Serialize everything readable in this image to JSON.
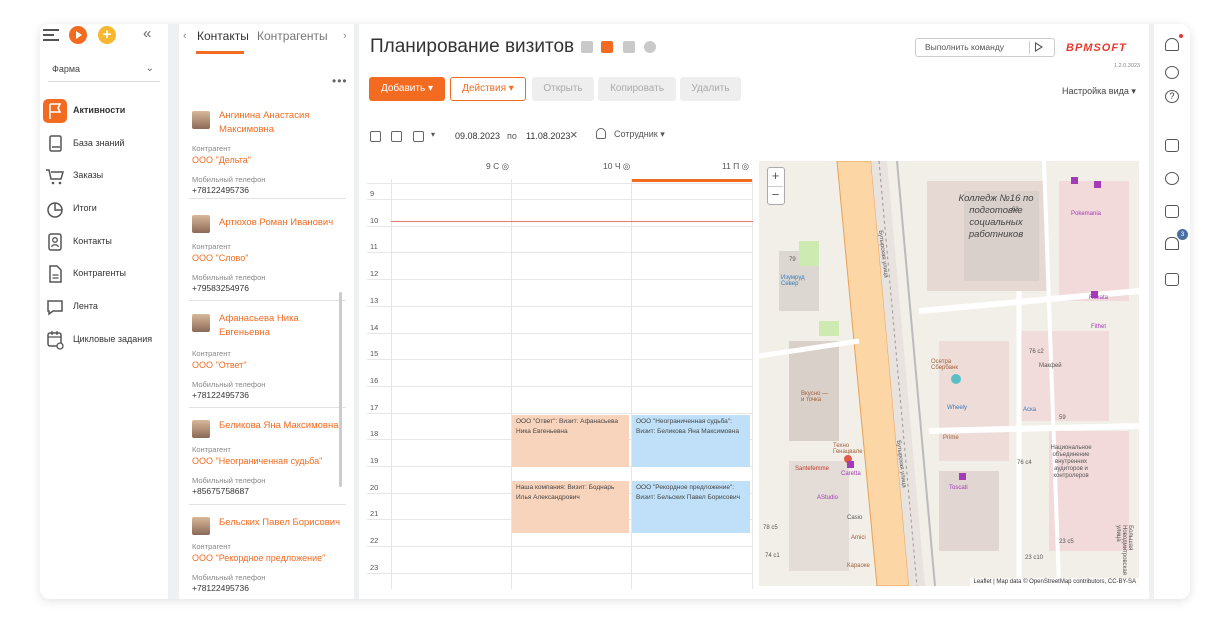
{
  "workspace": "Фарма",
  "nav": [
    {
      "label": "Активности",
      "icon": "flag-icon"
    },
    {
      "label": "База знаний",
      "icon": "book-icon"
    },
    {
      "label": "Заказы",
      "icon": "cart-icon"
    },
    {
      "label": "Итоги",
      "icon": "pie-chart-icon"
    },
    {
      "label": "Контакты",
      "icon": "contact-card-icon"
    },
    {
      "label": "Контрагенты",
      "icon": "document-icon"
    },
    {
      "label": "Лента",
      "icon": "chat-icon"
    },
    {
      "label": "Цикловые задания",
      "icon": "calendar-location-icon"
    }
  ],
  "contacts": {
    "tabs": [
      "Контакты",
      "Контрагенты"
    ],
    "field_account": "Контрагент",
    "field_phone": "Мобильный телефон",
    "items": [
      {
        "name": "Ангинина Анастасия Максимовна",
        "account": "ООО \"Дельта\"",
        "phone": "+78122495736"
      },
      {
        "name": "Артюхов Роман Иванович",
        "account": "ООО \"Слово\"",
        "phone": "+79583254976"
      },
      {
        "name": "Афанасьева Ника Евгеньевна",
        "account": "ООО \"Ответ\"",
        "phone": "+78122495736"
      },
      {
        "name": "Беликова Яна Максимовна",
        "account": "ООО \"Неограниченная судьба\"",
        "phone": "+85675758687"
      },
      {
        "name": "Бельских Павел Борисович",
        "account": "ООО \"Рекордное предложение\"",
        "phone": "+78122495736"
      }
    ]
  },
  "header": {
    "title": "Планирование визитов",
    "add": "Добавить",
    "actions": "Действия",
    "open": "Открыть",
    "copy": "Копировать",
    "delete": "Удалить",
    "command_placeholder": "Выполнить команду",
    "logo": "BPMSOFT",
    "version": "1.2.0.3023",
    "view_settings": "Настройка вида"
  },
  "filter": {
    "date_from": "09.08.2023",
    "to": "по",
    "date_to": "11.08.2023",
    "employee": "Сотрудник"
  },
  "schedule": {
    "days": [
      "9 С",
      "10 Ч",
      "11 П"
    ],
    "hours": [
      "9",
      "10",
      "11",
      "12",
      "13",
      "14",
      "15",
      "16",
      "17",
      "18",
      "19",
      "20",
      "21",
      "22",
      "23"
    ],
    "events": [
      {
        "text": "ООО \"Ответ\": Визит: Афанасьева Ника Евгеньевна",
        "color": "#f9d4bd"
      },
      {
        "text": "ООО \"Неограниченная судьба\": Визит: Беликова Яна Максимовна",
        "color": "#bfe0f8"
      },
      {
        "text": "Наша компания: Визит: Боднарь Илья Александрович",
        "color": "#f9d4bd"
      },
      {
        "text": "ООО \"Рекордное предложение\": Визит: Бельских Павел Борисович",
        "color": "#bfe0f8"
      }
    ]
  },
  "map": {
    "college": "Колледж №16 по подготовке социальных работников",
    "street1": "Бутырская улица",
    "street2": "Большая Новодмитровская улица",
    "labels": [
      "79",
      "Изумруд Север",
      "63",
      "Pokemania",
      "Rukata",
      "Fithet",
      "76 с2",
      "Осетра Сбербанк",
      "Макфей",
      "Wheely",
      "Prime",
      "Аска",
      "59",
      "Национальное объединение внутренних аудиторов и контролеров",
      "76 с4",
      "Toscati",
      "Вкусно — и точка",
      "Техно Генацвале",
      "Santefemme",
      "Caretta",
      "AStudio",
      "Casio",
      "Amici",
      "Караоке",
      "78 с5",
      "74 с1",
      "23 с5",
      "23 с10"
    ],
    "attribution": "Leaflet | Map data © OpenStreetMap contributors, CC-BY-SA"
  },
  "right_nav": {
    "notifications_badge": "3"
  }
}
